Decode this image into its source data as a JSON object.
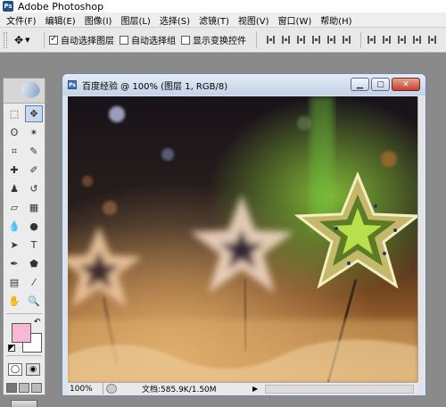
{
  "app": {
    "title": "Adobe Photoshop",
    "logo_text": "Ps"
  },
  "menubar": {
    "items": [
      "文件(F)",
      "编辑(E)",
      "图像(I)",
      "图层(L)",
      "选择(S)",
      "滤镜(T)",
      "视图(V)",
      "窗口(W)",
      "帮助(H)"
    ]
  },
  "options": {
    "tool_preset_icon": "move-tool-icon",
    "auto_select_layer": {
      "label": "自动选择图层",
      "checked": true
    },
    "auto_select_group": {
      "label": "自动选择组",
      "checked": false
    },
    "show_transform": {
      "label": "显示变换控件",
      "checked": false
    }
  },
  "toolbox": {
    "foreground_color": "#f7b8d6",
    "background_color": "#ffffff"
  },
  "document": {
    "title": "百度经验 @ 100% (图层 1, RGB/8)",
    "icon_text": "Ps",
    "zoom": "100%",
    "doc_size": "文档:585.9K/1.50M"
  }
}
